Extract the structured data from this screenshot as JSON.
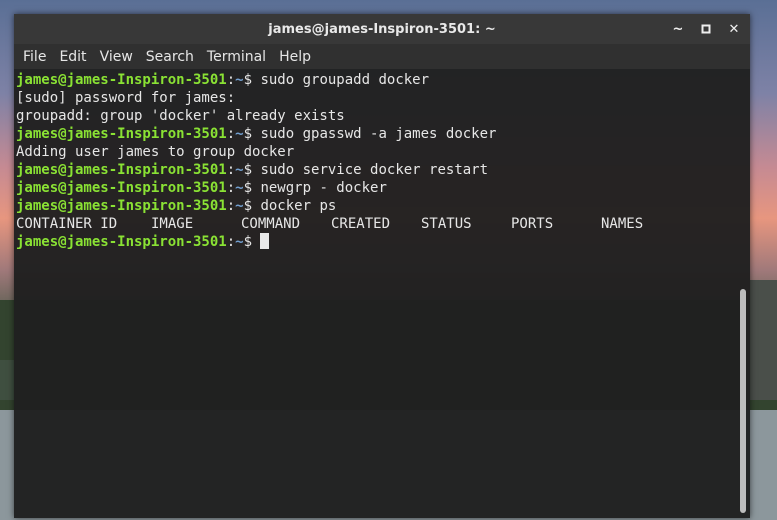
{
  "window": {
    "title": "james@james-Inspiron-3501: ~",
    "buttons": {
      "minimize": "~",
      "maximize": "▫",
      "close": "✕"
    }
  },
  "menubar": [
    "File",
    "Edit",
    "View",
    "Search",
    "Terminal",
    "Help"
  ],
  "terminal": {
    "prompt_user": "james@james-Inspiron-3501",
    "prompt_path": "~",
    "lines": [
      {
        "type": "cmd",
        "text": "sudo groupadd docker"
      },
      {
        "type": "out",
        "text": "[sudo] password for james:"
      },
      {
        "type": "out",
        "text": "groupadd: group 'docker' already exists"
      },
      {
        "type": "cmd",
        "text": "sudo gpasswd -a james docker"
      },
      {
        "type": "out",
        "text": "Adding user james to group docker"
      },
      {
        "type": "cmd",
        "text": "sudo service docker restart"
      },
      {
        "type": "cmd",
        "text": "newgrp - docker"
      },
      {
        "type": "cmd",
        "text": "docker ps"
      }
    ],
    "ps_header": [
      "CONTAINER ID",
      "IMAGE",
      "COMMAND",
      "CREATED",
      "STATUS",
      "PORTS",
      "NAMES"
    ]
  },
  "colors": {
    "prompt_user": "#8ae234",
    "prompt_path": "#729fcf",
    "text": "#e6e6e6",
    "titlebar": "#383838"
  }
}
